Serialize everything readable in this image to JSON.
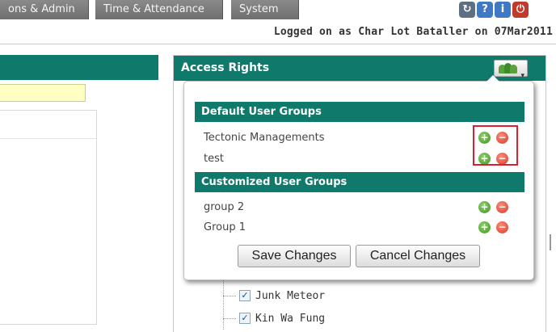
{
  "nav": {
    "tabs": [
      "ons & Admin",
      "Time & Attendance",
      "System"
    ],
    "tool_icons": [
      "refresh-icon",
      "help-icon",
      "info-icon",
      "power-icon"
    ]
  },
  "session": {
    "logged_on": "Logged on as Char Lot Bataller on 07Mar2011"
  },
  "access_rights": {
    "title": "Access Rights",
    "dropdown_icon": "user-group-icon",
    "tree_items": [
      {
        "label": "Junk Meteor",
        "checked": true
      },
      {
        "label": "Kin Wa Fung",
        "checked": true
      }
    ]
  },
  "popup": {
    "default_heading": "Default User Groups",
    "default_groups": [
      "Tectonic Managements",
      "test"
    ],
    "custom_heading": "Customized User Groups",
    "custom_groups": [
      "group 2",
      "Group 1"
    ],
    "save_label": "Save Changes",
    "cancel_label": "Cancel Changes"
  },
  "colors": {
    "header_teal": "#0f7a6b",
    "add_green": "#3f9422",
    "remove_red": "#d63b27",
    "highlight_red": "#d8212f",
    "input_yellow": "#ffffc4"
  }
}
